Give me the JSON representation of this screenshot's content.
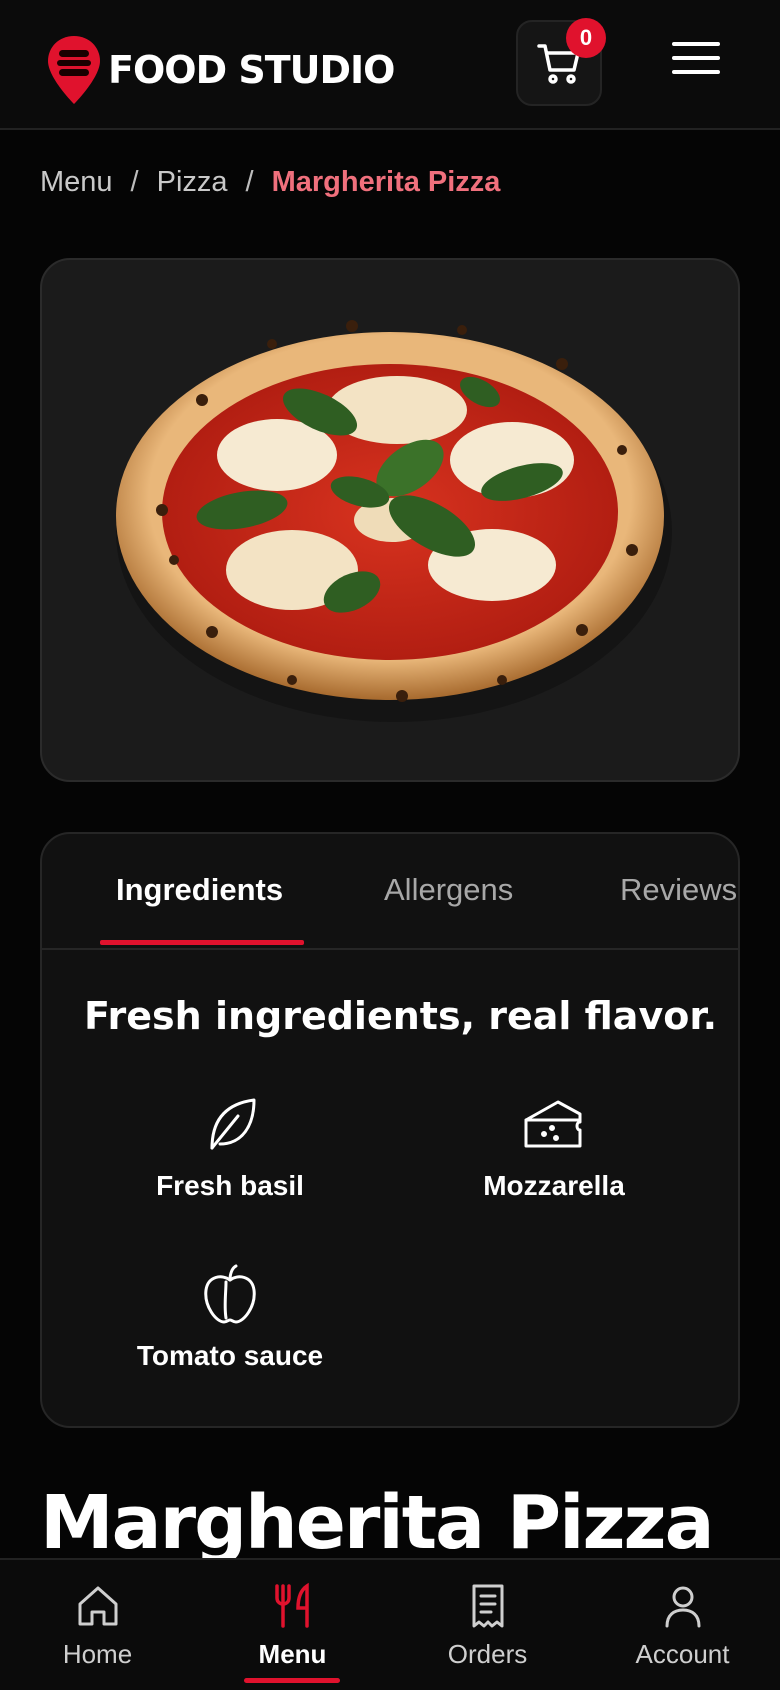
{
  "brand": {
    "name": "FOOD STUDIO",
    "accent": "#e0122d"
  },
  "header": {
    "cart_count": "0",
    "cart_icon": "cart-icon",
    "menu_icon": "hamburger-icon"
  },
  "breadcrumb": {
    "items": [
      "Menu",
      "Pizza"
    ],
    "current": "Margherita Pizza",
    "separator": "/"
  },
  "product": {
    "image_alt": "margherita-pizza-image",
    "title": "Margherita Pizza"
  },
  "tabs": [
    {
      "label": "Ingredients",
      "active": true
    },
    {
      "label": "Allergens",
      "active": false
    },
    {
      "label": "Reviews",
      "active": false
    }
  ],
  "ingredients": {
    "heading": "Fresh ingredients, real flavor.",
    "items": [
      {
        "label": "Fresh basil",
        "icon": "leaf-icon"
      },
      {
        "label": "Mozzarella",
        "icon": "cheese-icon"
      },
      {
        "label": "Tomato sauce",
        "icon": "apple-icon"
      }
    ]
  },
  "bottom_nav": [
    {
      "label": "Home",
      "icon": "home-icon",
      "active": false
    },
    {
      "label": "Menu",
      "icon": "utensils-icon",
      "active": true
    },
    {
      "label": "Orders",
      "icon": "receipt-icon",
      "active": false
    },
    {
      "label": "Account",
      "icon": "user-icon",
      "active": false
    }
  ]
}
